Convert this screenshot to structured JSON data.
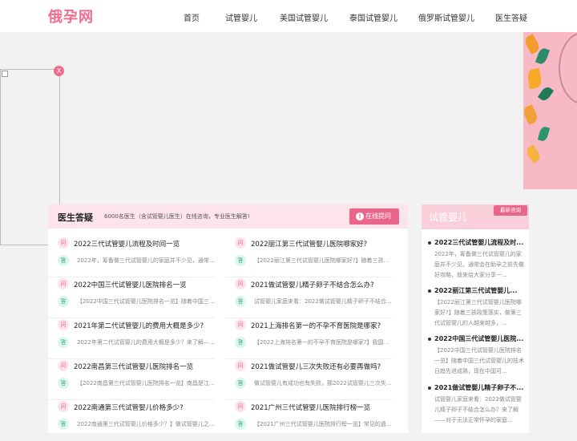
{
  "header": {
    "logo": "俄孕网",
    "nav": [
      "首页",
      "试管婴儿",
      "美国试管婴儿",
      "泰国试管婴儿",
      "俄罗斯试管婴儿",
      "医生答疑"
    ]
  },
  "ad": {
    "close_label": "X"
  },
  "qa_panel": {
    "title": "医生答疑",
    "subtitle": "6000名医生（含试管婴儿医生）在线咨询，专业医生解答!",
    "ask_button": "在线提问",
    "ask_icon": "!",
    "q_mark": "问",
    "a_mark": "答",
    "left": [
      {
        "q": "2022三代试管婴儿流程及时间一览",
        "a": "2022年，筹备做三代试管婴儿的家庭并不少见，通常会在..."
      },
      {
        "q": "2022中国三代试管婴儿医院排名一览",
        "a": "【2022中国三代试管婴儿医院排名一览】随着中国三代试..."
      },
      {
        "q": "2021年第二代试管婴儿的费用大概是多少?",
        "a": "2022年第二代试管婴儿的费用大概是多少？来了解——二..."
      },
      {
        "q": "2022南昌第三代试管婴儿医院排名一览",
        "a": "【2022南昌第三代试管婴儿医院排名一览】南昌是江西省..."
      },
      {
        "q": "2022南通第三代试管婴儿价格多少?",
        "a": "2022南通第三代试管婴儿价格多少？】做试管婴儿之前..."
      }
    ],
    "right": [
      {
        "q": "2022丽江第三代试管婴儿医院哪家好?",
        "a": "【2022丽江第三代试管婴儿医院哪家好?】随着三孩政策..."
      },
      {
        "q": "2021做试管婴儿精子卵子不结合怎么办?",
        "a": "试管婴儿家庭来看：2022做试管婴儿精子卵子不结合怎么..."
      },
      {
        "q": "2021上海排名第一的不孕不育医院是哪家?",
        "a": "【2022上海排名第一的不孕不育医院是哪家?】我国不孕..."
      },
      {
        "q": "2021做试管婴儿三次失败还有必要再做吗?",
        "a": "做试管婴儿有成功也有失败，那2022试管婴儿三次失败还..."
      },
      {
        "q": "2021广州三代试管婴儿医院排行榜一览",
        "a": "【2021广州三代试管婴儿医院排行榜一览】常见的遗传病..."
      }
    ]
  },
  "sidebar": {
    "title": "试管婴儿",
    "badge": "最新咨询",
    "items": [
      {
        "title": "2022三代试管婴儿流程及时...",
        "desc": "2022年，筹备做三代试管婴儿的家庭并不少见，通常会在助孕之前先做好攻略，就来给大家分享一..."
      },
      {
        "title": "2022丽江第三代试管婴儿...",
        "desc": "【2022丽江第三代试管婴儿医院哪家好?】随着三孩政策落实，做第三代试管婴儿的人越来越多，..."
      },
      {
        "title": "2022中国三代试管婴儿医院...",
        "desc": "【2022中国三代试管婴儿医院排名一览】随着中国三代试管婴儿的技术日趋先进成熟，现在中国可..."
      },
      {
        "title": "2021做试管婴儿精子卵子不...",
        "desc": "试管婴儿家庭来看：2022做试管婴儿精子卵子不结合怎么办？来了解——对于无法正常怀孕的家庭..."
      }
    ]
  },
  "colors": {
    "accent": "#e9668a",
    "logo": "#f06c8e",
    "header_pink": "#fde4ea",
    "answer_green": "#3aa98a"
  }
}
